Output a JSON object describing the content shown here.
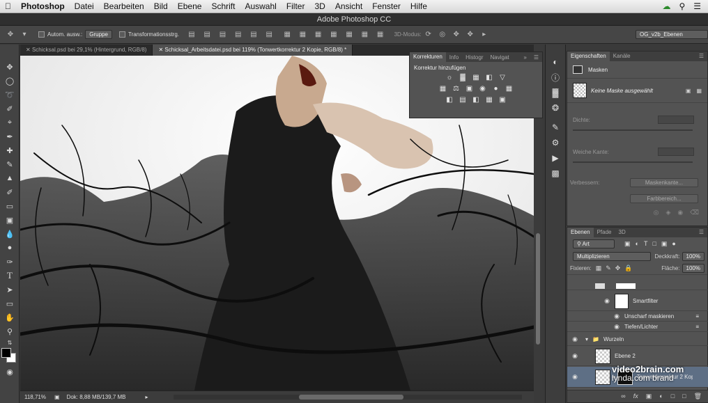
{
  "menubar": {
    "apple": "",
    "app": "Photoshop",
    "items": [
      "Datei",
      "Bearbeiten",
      "Bild",
      "Ebene",
      "Schrift",
      "Auswahl",
      "Filter",
      "3D",
      "Ansicht",
      "Fenster",
      "Hilfe"
    ]
  },
  "window": {
    "title": "Adobe Photoshop CC"
  },
  "options": {
    "auto_select_label": "Autom. ausw.:",
    "auto_select_value": "Gruppe",
    "transform_label": "Transformationsstrg.",
    "mode3d_label": "3D-Modus:",
    "workspace": "OG_v2b_Ebenen"
  },
  "tabs": [
    {
      "label": "Schicksal.psd bei 29,1% (Hintergrund, RGB/8)"
    },
    {
      "label": "Schicksal_Arbeitsdatei.psd bei 119% (Tonwertkorrektur 2 Kopie, RGB/8) *"
    }
  ],
  "adjustments": {
    "tabs": [
      "Korrekturen",
      "Info",
      "Histogr",
      "Navigat"
    ],
    "heading": "Korrektur hinzufügen"
  },
  "properties": {
    "tabs": [
      "Eigenschaften",
      "Kanäle"
    ],
    "section": "Masken",
    "mask_status": "Keine Maske ausgewählt",
    "density_label": "Dichte:",
    "feather_label": "Weiche Kante:",
    "refine_label": "Verbessern:",
    "mask_edge_button": "Maskenkante...",
    "color_range_button": "Farbbereich..."
  },
  "layers": {
    "tabs": [
      "Ebenen",
      "Pfade",
      "3D"
    ],
    "filter_kind": "Art",
    "blend_mode": "Multiplizieren",
    "opacity_label": "Deckkraft:",
    "opacity_value": "100%",
    "lock_label": "Fixieren:",
    "fill_label": "Fläche:",
    "fill_value": "100%",
    "rows": {
      "smartfilter": "Smartfilter",
      "unsharp": "Unscharf maskieren",
      "shadows": "Tiefen/Lichter",
      "group": "Wurzeln",
      "layer2": "Ebene 2",
      "adjust": "Tonwertkorrektur 2 Kopie"
    }
  },
  "status": {
    "zoom": "118,71%",
    "doc": "Dok: 8,88 MB/139,7 MB"
  },
  "watermark": {
    "line1": "video2brain.com",
    "line2": "lynda.com brand"
  },
  "colors": {
    "ui_dark": "#3a3a3a",
    "panel": "#535353",
    "canvas_bg": "#f4f4f4"
  }
}
